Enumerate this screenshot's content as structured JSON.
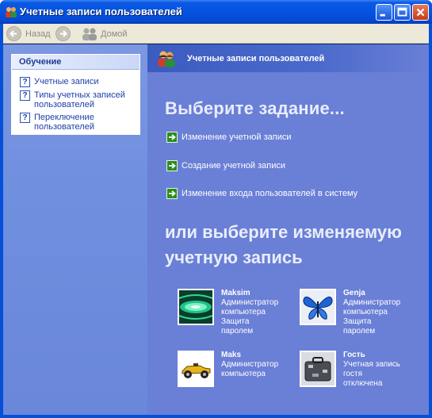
{
  "window": {
    "title": "Учетные записи пользователей",
    "title_icon": "user-accounts-icon",
    "controls": [
      "minimize-icon",
      "maximize-icon",
      "close-icon"
    ]
  },
  "toolbar": {
    "back_label": "Назад",
    "home_label": "Домой"
  },
  "sidebar": {
    "section_title": "Обучение",
    "items": [
      {
        "label": "Учетные записи",
        "icon": "help-icon"
      },
      {
        "label": "Типы учетных записей пользователей",
        "icon": "help-icon"
      },
      {
        "label": "Переключение пользователей",
        "icon": "help-icon"
      }
    ]
  },
  "main": {
    "header_title": "Учетные записи пользователей",
    "heading": "Выберите задание...",
    "tasks": [
      {
        "label": "Изменение учетной записи",
        "icon": "green-arrow-icon"
      },
      {
        "label": "Создание учетной записи",
        "icon": "green-arrow-icon"
      },
      {
        "label": "Изменение входа пользователей в систему",
        "icon": "green-arrow-icon"
      }
    ],
    "subheading_line1": "или выберите изменяемую",
    "subheading_line2": "учетную запись",
    "accounts": [
      {
        "name": "Maksim",
        "lines": [
          "Администратор",
          "компьютера",
          "Защита",
          "паролем"
        ],
        "picture": "green-swirl-picture"
      },
      {
        "name": "Genja",
        "lines": [
          "Администратор",
          "компьютера",
          "Защита",
          "паролем"
        ],
        "picture": "butterfly-picture"
      },
      {
        "name": "Maks",
        "lines": [
          "Администратор",
          "компьютера"
        ],
        "picture": "race-car-picture"
      },
      {
        "name": "Гость",
        "lines": [
          "Учетная запись",
          "гостя",
          "отключена"
        ],
        "picture": "suitcase-picture"
      }
    ]
  },
  "colors": {
    "titlebar": "#0554e0",
    "left_pane": "#6f8fdf",
    "right_pane": "#6a7fd6",
    "task_arrow": "#2a8d1f"
  }
}
